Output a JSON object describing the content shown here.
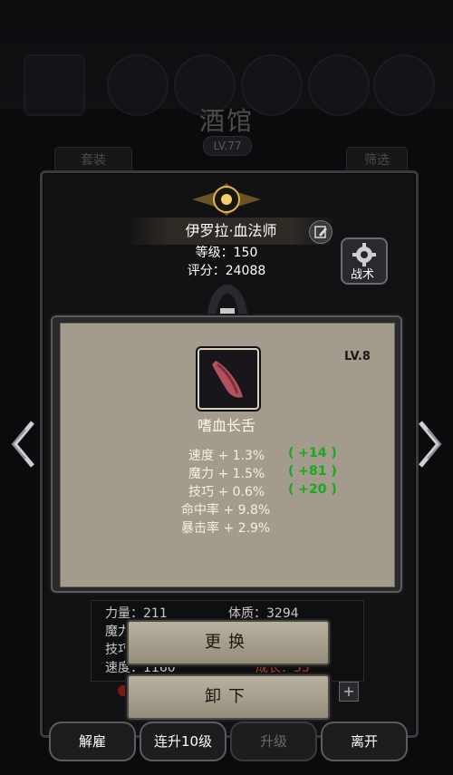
{
  "background": {
    "title": "酒馆",
    "level": "LV.77",
    "outfit_label": "套装",
    "filter_label": "筛选"
  },
  "hero": {
    "name": "伊罗拉·血法师",
    "level_text": "等级：150",
    "score_text": "评分：24088",
    "tactics_label": "战术"
  },
  "attributes": {
    "row1_left": "力量：211",
    "row1_right": "体质：3294",
    "row2_left": "魔力",
    "row3_left": "技巧",
    "row4_left": "速度：1160",
    "row4_right": "成长：55"
  },
  "item": {
    "level": "LV.8",
    "name": "嗜血长舌",
    "bonuses": [
      {
        "label": "速度 + 1.3%",
        "delta": "( +14 )"
      },
      {
        "label": "魔力 + 1.5%",
        "delta": "( +81 )"
      },
      {
        "label": "技巧 + 0.6%",
        "delta": "( +20 )"
      },
      {
        "label": "命中率 + 9.8%",
        "delta": ""
      },
      {
        "label": "暴击率 + 2.9%",
        "delta": ""
      }
    ]
  },
  "actions": {
    "replace": "更换",
    "unequip": "卸下"
  },
  "bottom_bar": {
    "dismiss": "解雇",
    "upgrade10": "连升10级",
    "upgrade": "升级",
    "leave": "离开"
  },
  "colors": {
    "panel_bg": "#121214",
    "popup_bg": "#a39b8b",
    "bonus_green": "#19a81e"
  },
  "icons": [
    "edit-icon",
    "gear-icon",
    "tongue-item-icon",
    "chevron-left-icon",
    "chevron-right-icon",
    "plus-icon"
  ]
}
